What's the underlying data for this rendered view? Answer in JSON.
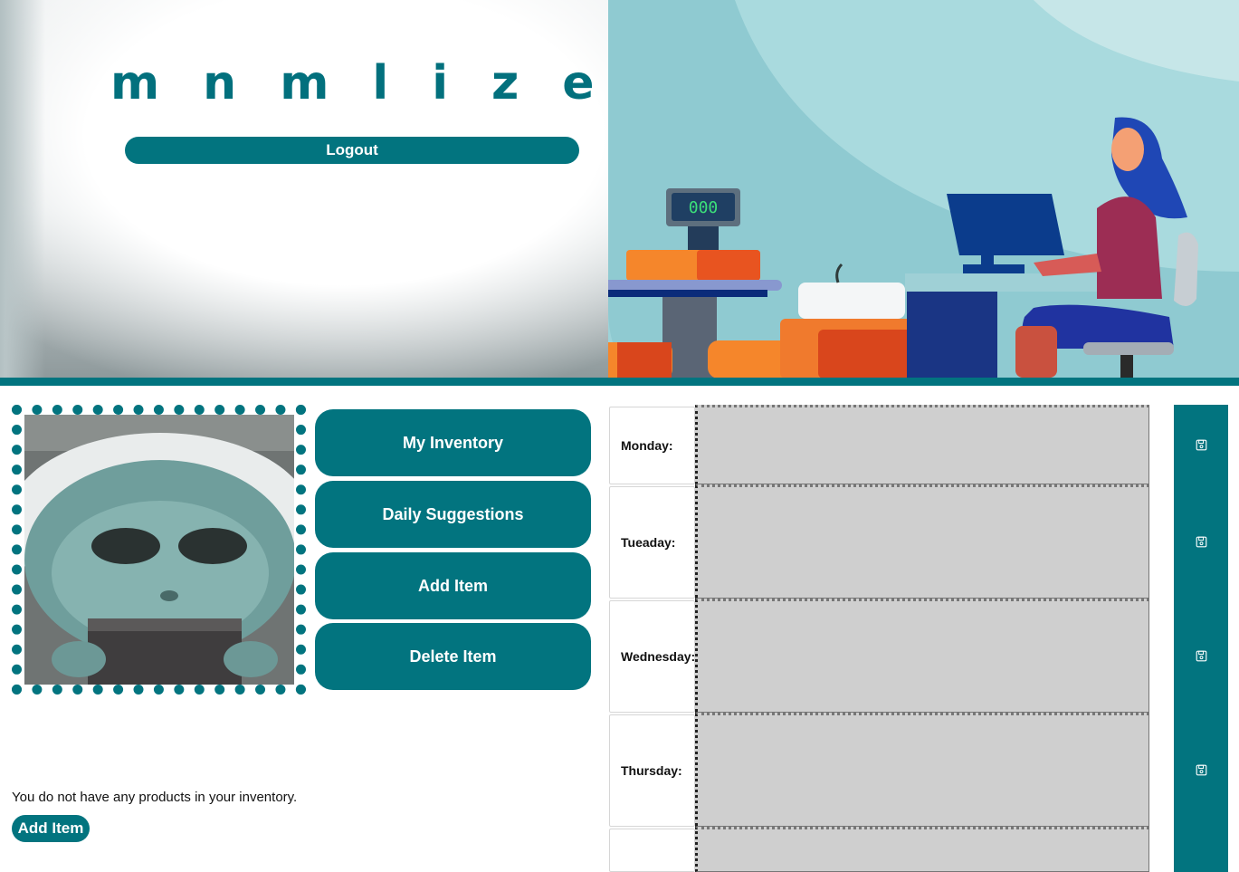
{
  "brand": {
    "name": "mnmlize"
  },
  "header": {
    "logout_label": "Logout"
  },
  "nav": {
    "buttons": [
      {
        "label": "My Inventory"
      },
      {
        "label": "Daily Suggestions"
      },
      {
        "label": "Add Item"
      },
      {
        "label": "Delete Item"
      }
    ]
  },
  "inventory": {
    "empty_message": "You do not have any products in your inventory.",
    "add_item_label": "Add Item"
  },
  "schedule": {
    "days": [
      {
        "label": "Monday:",
        "value": ""
      },
      {
        "label": "Tueaday:",
        "value": ""
      },
      {
        "label": "Wednesday:",
        "value": ""
      },
      {
        "label": "Thursday:",
        "value": ""
      },
      {
        "label": "",
        "value": ""
      }
    ],
    "save_icon": "floppy-disk-icon"
  },
  "illustration": {
    "scale_display": "000"
  },
  "colors": {
    "accent": "#02747f",
    "field_bg": "#cfcfcf"
  }
}
